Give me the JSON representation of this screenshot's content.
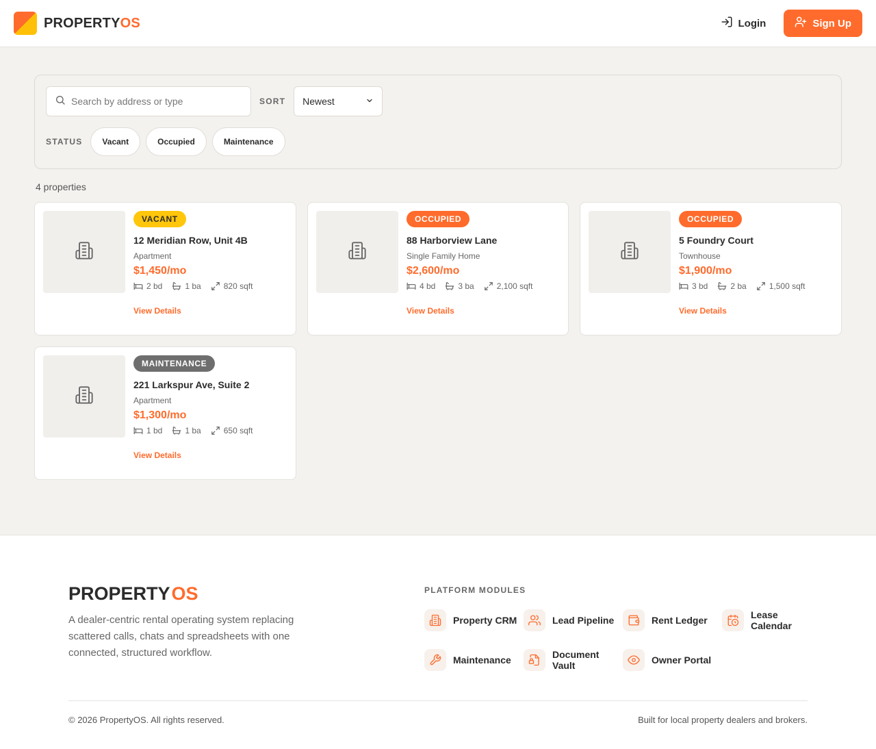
{
  "header": {
    "brand_main": "PROPERTY",
    "brand_accent": "OS",
    "login_label": "Login",
    "signup_label": "Sign Up"
  },
  "filters": {
    "search_placeholder": "Search by address or type",
    "sort_label": "SORT",
    "sort_value": "Newest",
    "status_label": "STATUS",
    "status_chips": [
      "Vacant",
      "Occupied",
      "Maintenance"
    ]
  },
  "results": {
    "count_text": "4 properties"
  },
  "properties": [
    {
      "status": "VACANT",
      "status_key": "vacant",
      "address": "12 Meridian Row, Unit 4B",
      "type": "Apartment",
      "price": "$1,450/mo",
      "beds": "2 bd",
      "baths": "1 ba",
      "sqft": "820 sqft",
      "link": "View Details"
    },
    {
      "status": "OCCUPIED",
      "status_key": "occupied",
      "address": "88 Harborview Lane",
      "type": "Single Family Home",
      "price": "$2,600/mo",
      "beds": "4 bd",
      "baths": "3 ba",
      "sqft": "2,100 sqft",
      "link": "View Details"
    },
    {
      "status": "OCCUPIED",
      "status_key": "occupied",
      "address": "5 Foundry Court",
      "type": "Townhouse",
      "price": "$1,900/mo",
      "beds": "3 bd",
      "baths": "2 ba",
      "sqft": "1,500 sqft",
      "link": "View Details"
    },
    {
      "status": "MAINTENANCE",
      "status_key": "maintenance",
      "address": "221 Larkspur Ave, Suite 2",
      "type": "Apartment",
      "price": "$1,300/mo",
      "beds": "1 bd",
      "baths": "1 ba",
      "sqft": "650 sqft",
      "link": "View Details"
    }
  ],
  "footer": {
    "brand_main": "PROPERTY",
    "brand_accent": "OS",
    "description": "A dealer-centric rental operating system replacing scattered calls, chats and spreadsheets with one connected, structured workflow.",
    "modules_title": "PLATFORM MODULES",
    "modules": [
      {
        "label": "Property CRM",
        "icon": "building-icon"
      },
      {
        "label": "Lead Pipeline",
        "icon": "users-icon"
      },
      {
        "label": "Rent Ledger",
        "icon": "wallet-icon"
      },
      {
        "label": "Lease Calendar",
        "icon": "calendar-clock-icon"
      },
      {
        "label": "Maintenance",
        "icon": "wrench-icon"
      },
      {
        "label": "Document Vault",
        "icon": "file-lock-icon"
      },
      {
        "label": "Owner Portal",
        "icon": "eye-icon"
      }
    ],
    "copyright": "© 2026 PropertyOS. All rights reserved.",
    "tagline": "Built for local property dealers and brokers."
  },
  "colors": {
    "accent": "#ff6b2c",
    "vacant": "#ffc60b",
    "maintenance": "#6e6e6e",
    "background": "#f4f2ef"
  }
}
